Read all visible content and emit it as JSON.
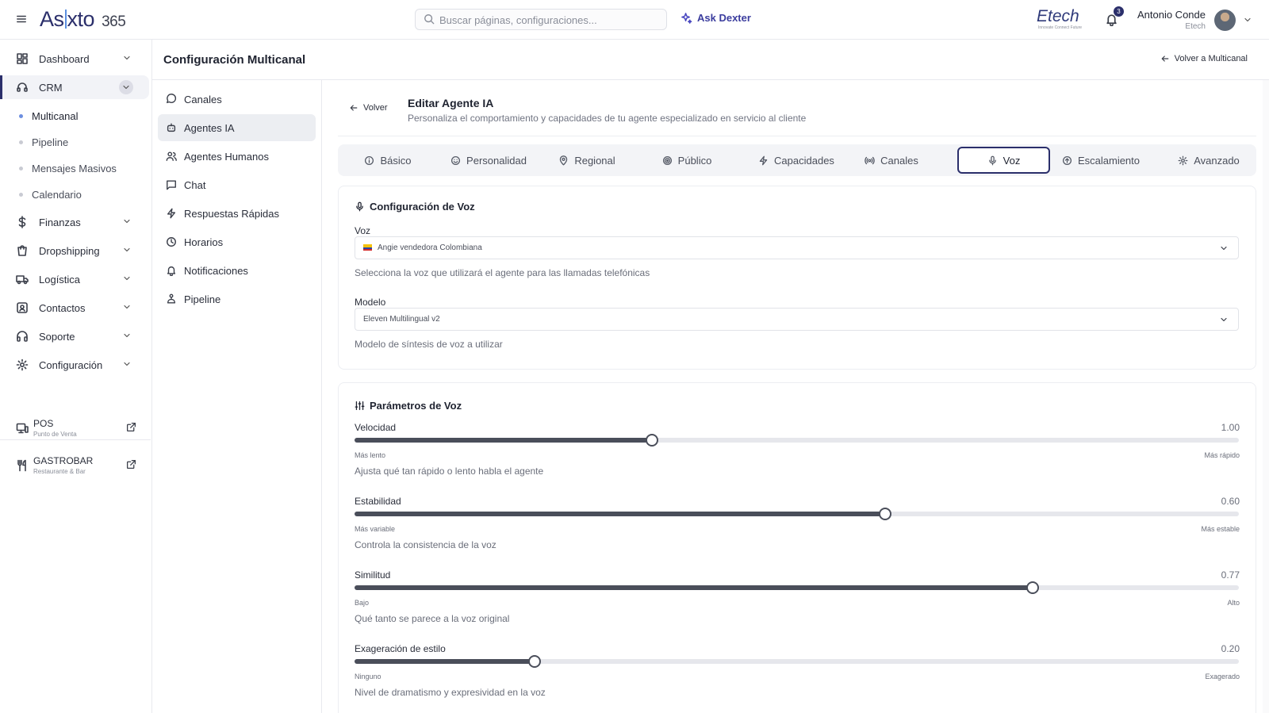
{
  "app": {
    "logo_left": "As",
    "logo_right": "xto",
    "logo_version": "365"
  },
  "search": {
    "placeholder": "Buscar páginas, configuraciones..."
  },
  "ask": {
    "label": "Ask Dexter"
  },
  "brand": {
    "name": "Etech",
    "tagline": "Innovate Connect Future"
  },
  "notifications": {
    "count": "3"
  },
  "user": {
    "name": "Antonio Conde",
    "org": "Etech"
  },
  "sidebar": {
    "items": [
      {
        "label": "Dashboard"
      },
      {
        "label": "CRM"
      },
      {
        "label": "Finanzas"
      },
      {
        "label": "Dropshipping"
      },
      {
        "label": "Logística"
      },
      {
        "label": "Contactos"
      },
      {
        "label": "Soporte"
      },
      {
        "label": "Configuración"
      }
    ],
    "crm_sub": [
      {
        "label": "Multicanal"
      },
      {
        "label": "Pipeline"
      },
      {
        "label": "Mensajes Masivos"
      },
      {
        "label": "Calendario"
      }
    ],
    "external": [
      {
        "title": "POS",
        "subtitle": "Punto de Venta"
      },
      {
        "title": "GASTROBAR",
        "subtitle": "Restaurante & Bar"
      }
    ]
  },
  "page": {
    "title": "Configuración Multicanal",
    "back_label": "Volver a Multicanal"
  },
  "menu": {
    "items": [
      {
        "label": "Canales",
        "icon": "message-circle-icon"
      },
      {
        "label": "Agentes IA",
        "icon": "bot-icon"
      },
      {
        "label": "Agentes Humanos",
        "icon": "users-icon"
      },
      {
        "label": "Chat",
        "icon": "message-square-icon"
      },
      {
        "label": "Respuestas Rápidas",
        "icon": "zap-icon"
      },
      {
        "label": "Horarios",
        "icon": "clock-icon"
      },
      {
        "label": "Notificaciones",
        "icon": "bell-icon"
      },
      {
        "label": "Pipeline",
        "icon": "workflow-icon"
      }
    ]
  },
  "editor": {
    "back_label": "Volver",
    "title": "Editar Agente IA",
    "subtitle": "Personaliza el comportamiento y capacidades de tu agente especializado en servicio al cliente"
  },
  "tabs": [
    {
      "label": "Básico"
    },
    {
      "label": "Personalidad"
    },
    {
      "label": "Regional"
    },
    {
      "label": "Público"
    },
    {
      "label": "Capacidades"
    },
    {
      "label": "Canales"
    },
    {
      "label": "Voz"
    },
    {
      "label": "Escalamiento"
    },
    {
      "label": "Avanzado"
    }
  ],
  "voice_config": {
    "title": "Configuración de Voz",
    "voice_label": "Voz",
    "voice_value": "Angie vendedora Colombiana",
    "voice_help": "Selecciona la voz que utilizará el agente para las llamadas telefónicas",
    "model_label": "Modelo",
    "model_value": "Eleven Multilingual v2",
    "model_help": "Modelo de síntesis de voz a utilizar"
  },
  "voice_params": {
    "title": "Parámetros de Voz",
    "sliders": [
      {
        "label": "Velocidad",
        "value": "1.00",
        "fraction": 0.336,
        "min_label": "Más lento",
        "max_label": "Más rápido",
        "help": "Ajusta qué tan rápido o lento habla el agente"
      },
      {
        "label": "Estabilidad",
        "value": "0.60",
        "fraction": 0.6,
        "min_label": "Más variable",
        "max_label": "Más estable",
        "help": "Controla la consistencia de la voz"
      },
      {
        "label": "Similitud",
        "value": "0.77",
        "fraction": 0.767,
        "min_label": "Bajo",
        "max_label": "Alto",
        "help": "Qué tanto se parece a la voz original"
      },
      {
        "label": "Exageración de estilo",
        "value": "0.20",
        "fraction": 0.204,
        "min_label": "Ninguno",
        "max_label": "Exagerado",
        "help": "Nivel de dramatismo y expresividad en la voz"
      }
    ]
  }
}
